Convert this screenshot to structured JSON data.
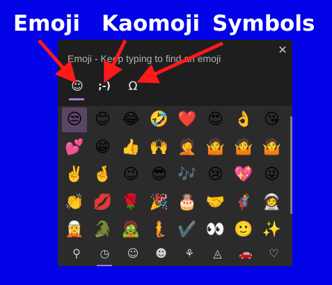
{
  "labels": {
    "emoji": "Emoji",
    "kaomoji": "Kaomoji",
    "symbols": "Symbols"
  },
  "panel": {
    "search_hint": "Emoji - Keep typing to find an emoji",
    "close_glyph": "✕",
    "tabs": [
      {
        "name": "emoji",
        "glyph": "☺"
      },
      {
        "name": "kaomoji",
        "glyph": ";-)"
      },
      {
        "name": "symbols",
        "glyph": "Ω"
      }
    ],
    "grid_rows": [
      [
        "😒",
        "😊",
        "😂",
        "🤣",
        "❤️",
        "😍",
        "👌",
        "😘"
      ],
      [
        "💕",
        "😁",
        "👍",
        "🙌",
        "🤦",
        "🤷",
        "🤷",
        "🤷"
      ],
      [
        "✌️",
        "🤞",
        "😉",
        "😎",
        "🎶",
        "😢",
        "💖",
        "😜"
      ],
      [
        "👏",
        "💋",
        "🌹",
        "🎉",
        "🎂",
        "🤝",
        "🦸",
        "🧑‍🚀"
      ],
      [
        "🧝",
        "🐊",
        "🧟",
        "🧜",
        "✔️",
        "👀",
        "🙂",
        "✨"
      ]
    ],
    "categories": [
      {
        "name": "search",
        "glyph": "⚲"
      },
      {
        "name": "recent",
        "glyph": "◷"
      },
      {
        "name": "smiley",
        "glyph": "☺"
      },
      {
        "name": "people",
        "glyph": "☻"
      },
      {
        "name": "celebration",
        "glyph": "⚘"
      },
      {
        "name": "food",
        "glyph": "◬"
      },
      {
        "name": "travel",
        "glyph": "🚗"
      },
      {
        "name": "heart",
        "glyph": "♡"
      }
    ]
  },
  "colors": {
    "background": "#0303e8",
    "arrow": "#ff1a1a",
    "accent": "#a77bd3"
  }
}
